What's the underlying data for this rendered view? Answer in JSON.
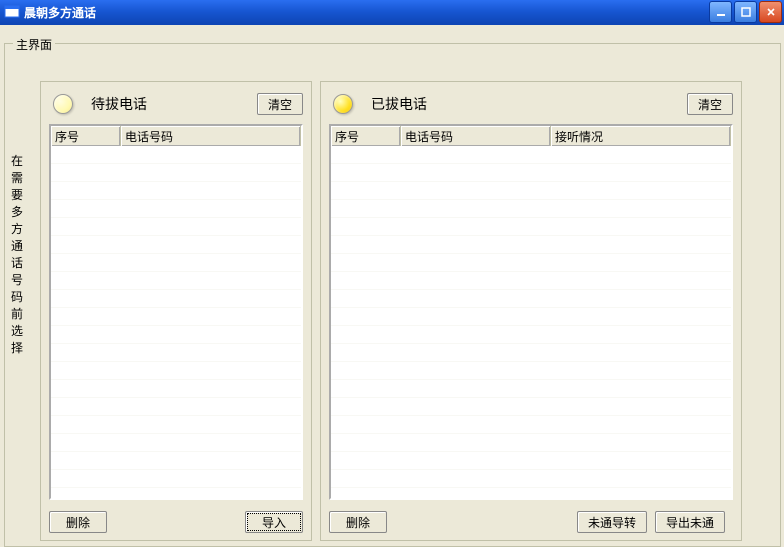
{
  "window": {
    "title": "晨朝多方通话"
  },
  "main_group": {
    "label": "主界面",
    "side_note": "在需要多方通话号码前选择"
  },
  "left_panel": {
    "title": "待拔电话",
    "clear_btn": "清空",
    "columns": {
      "idx": "序号",
      "phone": "电话号码"
    },
    "buttons": {
      "delete": "删除",
      "import": "导入"
    }
  },
  "right_panel": {
    "title": "已拔电话",
    "clear_btn": "清空",
    "columns": {
      "idx": "序号",
      "phone": "电话号码",
      "status": "接听情况"
    },
    "buttons": {
      "delete": "删除",
      "fwd_unreach": "未通导转",
      "export_unreach": "导出未通"
    }
  }
}
